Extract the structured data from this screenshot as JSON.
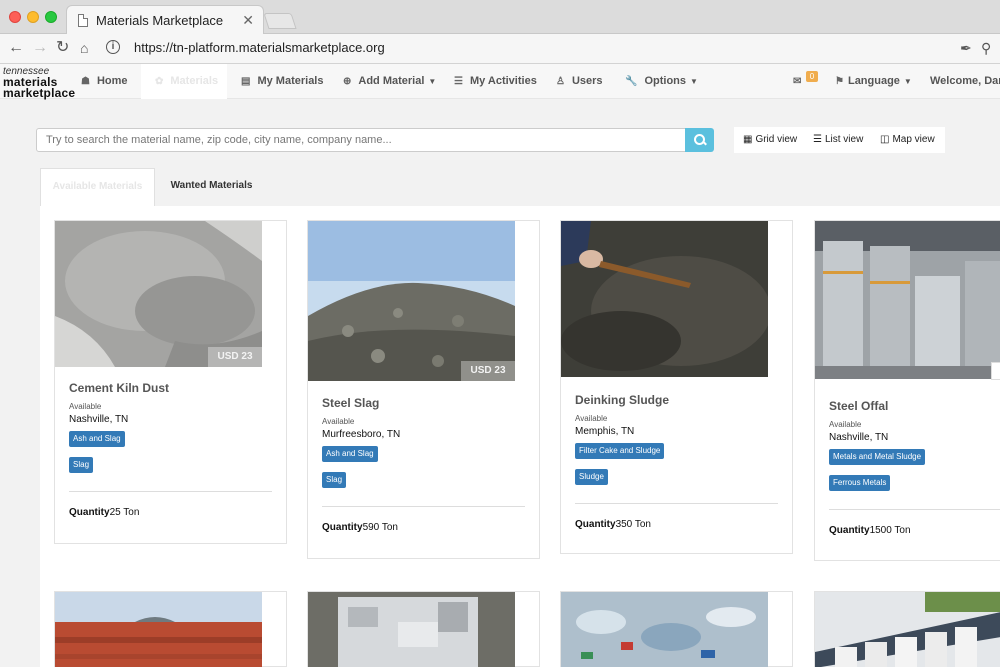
{
  "browser": {
    "tab_title": "Materials Marketplace",
    "tab_close": "✕",
    "url": "https://tn-platform.materialsmarketplace.org"
  },
  "logo": {
    "line1": "tennessee",
    "line2": "materials",
    "line3": "marketplace"
  },
  "nav": {
    "items": [
      {
        "label": "Home",
        "icon": "home-icon"
      },
      {
        "label": "Materials",
        "icon": "leaf-icon"
      },
      {
        "label": "My Materials",
        "icon": "table-icon"
      },
      {
        "label": "Add Material",
        "icon": "plus-circle-icon"
      },
      {
        "label": "My Activities",
        "icon": "list-icon"
      },
      {
        "label": "Users",
        "icon": "user-icon"
      },
      {
        "label": "Options",
        "icon": "wrench-icon"
      }
    ],
    "inbox_count": "0",
    "language_label": "Language",
    "welcome": "Welcome, Dan"
  },
  "search": {
    "placeholder": "Try to search the material name, zip code, city name, company name..."
  },
  "views": {
    "grid": "Grid view",
    "list": "List view",
    "map": "Map view"
  },
  "tabs": {
    "available": "Available Materials",
    "wanted": "Wanted Materials"
  },
  "cards": [
    {
      "title": "Cement Kiln Dust",
      "status": "Available",
      "location": "Nashville, TN",
      "tags": [
        "Ash and Slag",
        "Slag"
      ],
      "quantity_label": "Quantity",
      "quantity": "25 Ton",
      "price": "USD 23"
    },
    {
      "title": "Steel Slag",
      "status": "Available",
      "location": "Murfreesboro, TN",
      "tags": [
        "Ash and Slag",
        "Slag"
      ],
      "quantity_label": "Quantity",
      "quantity": "590 Ton",
      "price": "USD 23"
    },
    {
      "title": "Deinking Sludge",
      "status": "Available",
      "location": "Memphis, TN",
      "tags": [
        "Filter Cake and Sludge",
        "Sludge"
      ],
      "quantity_label": "Quantity",
      "quantity": "350 Ton"
    },
    {
      "title": "Steel Offal",
      "status": "Available",
      "location": "Nashville, TN",
      "tags": [
        "Metals and Metal Sludge",
        "Ferrous Metals"
      ],
      "quantity_label": "Quantity",
      "quantity": "1500 Ton"
    }
  ],
  "colors": {
    "primary": "#337ab7",
    "search_button": "#5bc0de",
    "badge": "#f0ad4e"
  }
}
